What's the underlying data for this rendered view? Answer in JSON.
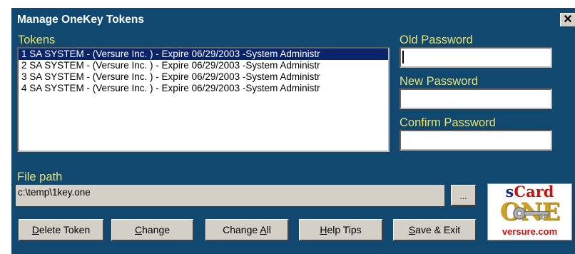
{
  "window": {
    "title": "Manage OneKey Tokens",
    "close_glyph": "✕"
  },
  "tokens": {
    "label": "Tokens",
    "items": [
      "1  SA SYSTEM - (Versure Inc. ) - Expire  06/29/2003 -System Administr",
      "2  SA SYSTEM - (Versure Inc. ) - Expire  06/29/2003 -System Administr",
      "3  SA SYSTEM - (Versure Inc. ) - Expire  06/29/2003 -System Administr",
      "4  SA SYSTEM - (Versure Inc. ) - Expire  06/29/2003 -System Administr"
    ],
    "selected_index": 0
  },
  "passwords": {
    "old_label": "Old Password",
    "old_value": "",
    "new_label": "New Password",
    "new_value": "",
    "confirm_label": "Confirm Password",
    "confirm_value": ""
  },
  "file": {
    "label": "File path",
    "value": "c:\\temp\\1key.one",
    "browse_label": "..."
  },
  "buttons": {
    "delete_pre": "",
    "delete_key": "D",
    "delete_post": "elete Token",
    "change_pre": "",
    "change_key": "C",
    "change_post": "hange",
    "change_all_pre": "Change ",
    "change_all_key": "A",
    "change_all_post": "ll",
    "help_pre": "",
    "help_key": "H",
    "help_post": "elp Tips",
    "save_pre": "",
    "save_key": "S",
    "save_post": "ave & Exit"
  },
  "logo": {
    "scard_s": "s",
    "scard_rest": "Card",
    "one": "ONE",
    "site": "versure.com"
  },
  "colors": {
    "background": "#10486f",
    "label_text": "#e6e27a",
    "selection": "#0a246a",
    "button_face": "#d4d0c8",
    "logo_red": "#c8100c",
    "logo_gold": "#c9a227"
  },
  "icons": {
    "close": "close-icon",
    "key": "key-icon"
  }
}
